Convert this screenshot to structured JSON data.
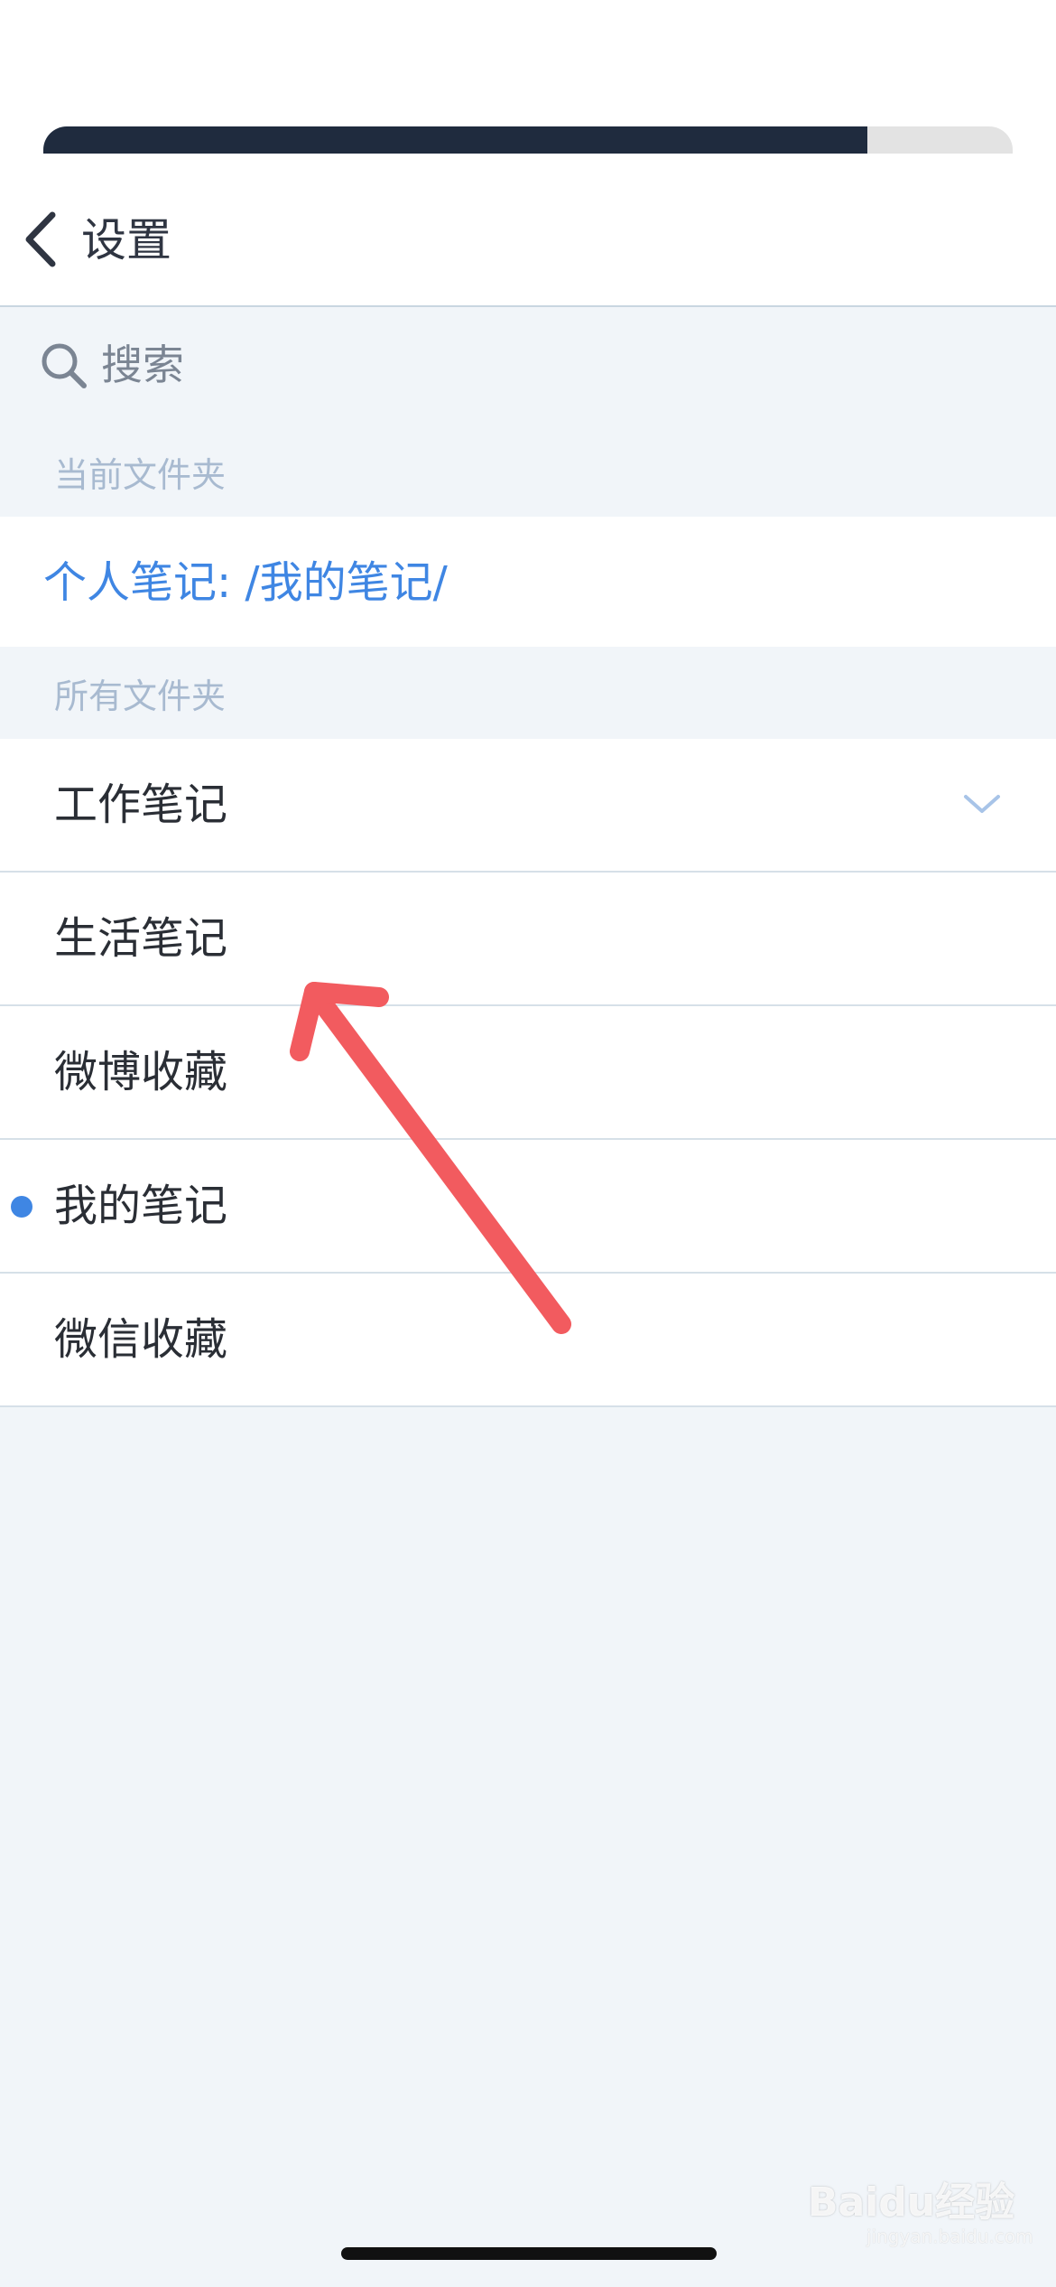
{
  "colors": {
    "accent": "#3f86e3",
    "background": "#f1f5f9",
    "progress_fill": "#1f2b3e",
    "annotation_arrow": "#f25b5f"
  },
  "progress": {
    "fraction": 0.85
  },
  "nav": {
    "back_icon": "chevron-left-icon",
    "title": "设置"
  },
  "search": {
    "icon": "search-icon",
    "placeholder": "搜索"
  },
  "current_section": {
    "header": "当前文件夹",
    "path": "个人笔记: /我的笔记/"
  },
  "all_section": {
    "header": "所有文件夹",
    "folders": [
      {
        "label": "工作笔记",
        "expandable": true,
        "current": false
      },
      {
        "label": "生活笔记",
        "expandable": false,
        "current": false
      },
      {
        "label": "微博收藏",
        "expandable": false,
        "current": false
      },
      {
        "label": "我的笔记",
        "expandable": false,
        "current": true
      },
      {
        "label": "微信收藏",
        "expandable": false,
        "current": false
      }
    ]
  },
  "watermark": {
    "brand": "Baidu经验",
    "url": "jingyan.baidu.com"
  }
}
